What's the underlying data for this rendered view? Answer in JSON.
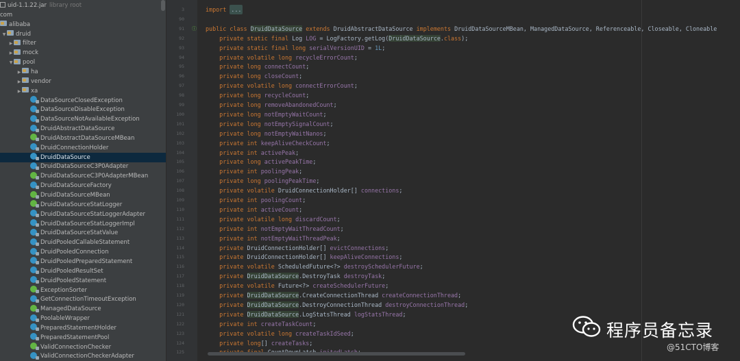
{
  "project_tree": {
    "rows": [
      {
        "label": "uid-1.1.22.jar",
        "hint": "library root",
        "icon": "jar-icon",
        "depth": 0,
        "caret": ""
      },
      {
        "label": "com",
        "icon": "none",
        "depth": 0,
        "caret": ""
      },
      {
        "label": "alibaba",
        "icon": "folder-icon",
        "depth": 0,
        "caret": ""
      },
      {
        "label": "druid",
        "icon": "folder-icon",
        "depth": 1,
        "caret": "▼"
      },
      {
        "label": "filter",
        "icon": "folder-icon",
        "depth": 2,
        "caret": "▶"
      },
      {
        "label": "mock",
        "icon": "folder-icon",
        "depth": 2,
        "caret": "▶"
      },
      {
        "label": "pool",
        "icon": "folder-icon",
        "depth": 2,
        "caret": "▼"
      },
      {
        "label": "ha",
        "icon": "folder-icon",
        "depth": 3,
        "caret": "▶"
      },
      {
        "label": "vendor",
        "icon": "folder-icon",
        "depth": 3,
        "caret": "▶"
      },
      {
        "label": "xa",
        "icon": "folder-icon",
        "depth": 3,
        "caret": "▶"
      },
      {
        "label": "DataSourceClosedException",
        "icon": "class-icon",
        "depth": 4,
        "caret": ""
      },
      {
        "label": "DataSourceDisableException",
        "icon": "class-icon",
        "depth": 4,
        "caret": ""
      },
      {
        "label": "DataSourceNotAvailableException",
        "icon": "class-icon",
        "depth": 4,
        "caret": ""
      },
      {
        "label": "DruidAbstractDataSource",
        "icon": "class-icon",
        "depth": 4,
        "caret": ""
      },
      {
        "label": "DruidAbstractDataSourceMBean",
        "icon": "interface-icon",
        "depth": 4,
        "caret": ""
      },
      {
        "label": "DruidConnectionHolder",
        "icon": "class-icon",
        "depth": 4,
        "caret": ""
      },
      {
        "label": "DruidDataSource",
        "icon": "class-icon",
        "depth": 4,
        "caret": "",
        "selected": true
      },
      {
        "label": "DruidDataSourceC3P0Adapter",
        "icon": "class-icon",
        "depth": 4,
        "caret": ""
      },
      {
        "label": "DruidDataSourceC3P0AdapterMBean",
        "icon": "interface-icon",
        "depth": 4,
        "caret": ""
      },
      {
        "label": "DruidDataSourceFactory",
        "icon": "class-icon",
        "depth": 4,
        "caret": ""
      },
      {
        "label": "DruidDataSourceMBean",
        "icon": "interface-icon",
        "depth": 4,
        "caret": ""
      },
      {
        "label": "DruidDataSourceStatLogger",
        "icon": "interface-icon",
        "depth": 4,
        "caret": ""
      },
      {
        "label": "DruidDataSourceStatLoggerAdapter",
        "icon": "class-icon",
        "depth": 4,
        "caret": ""
      },
      {
        "label": "DruidDataSourceStatLoggerImpl",
        "icon": "class-icon",
        "depth": 4,
        "caret": ""
      },
      {
        "label": "DruidDataSourceStatValue",
        "icon": "class-icon",
        "depth": 4,
        "caret": ""
      },
      {
        "label": "DruidPooledCallableStatement",
        "icon": "class-icon",
        "depth": 4,
        "caret": ""
      },
      {
        "label": "DruidPooledConnection",
        "icon": "class-icon",
        "depth": 4,
        "caret": ""
      },
      {
        "label": "DruidPooledPreparedStatement",
        "icon": "class-icon",
        "depth": 4,
        "caret": ""
      },
      {
        "label": "DruidPooledResultSet",
        "icon": "class-icon",
        "depth": 4,
        "caret": ""
      },
      {
        "label": "DruidPooledStatement",
        "icon": "class-icon",
        "depth": 4,
        "caret": ""
      },
      {
        "label": "ExceptionSorter",
        "icon": "interface-icon",
        "depth": 4,
        "caret": ""
      },
      {
        "label": "GetConnectionTimeoutException",
        "icon": "class-icon",
        "depth": 4,
        "caret": ""
      },
      {
        "label": "ManagedDataSource",
        "icon": "interface-icon",
        "depth": 4,
        "caret": ""
      },
      {
        "label": "PoolableWrapper",
        "icon": "class-icon",
        "depth": 4,
        "caret": ""
      },
      {
        "label": "PreparedStatementHolder",
        "icon": "class-icon",
        "depth": 4,
        "caret": ""
      },
      {
        "label": "PreparedStatementPool",
        "icon": "class-icon",
        "depth": 4,
        "caret": ""
      },
      {
        "label": "ValidConnectionChecker",
        "icon": "interface-icon",
        "depth": 4,
        "caret": ""
      },
      {
        "label": "ValidConnectionCheckerAdapter",
        "icon": "class-icon",
        "depth": 4,
        "caret": ""
      }
    ]
  },
  "editor": {
    "lines": [
      {
        "num": "3",
        "tokens": [
          {
            "t": "import ",
            "c": "kw"
          },
          {
            "t": "...",
            "c": "fold"
          }
        ]
      },
      {
        "num": "90",
        "tokens": []
      },
      {
        "num": "91",
        "mark": "ⓘ",
        "tokens": [
          {
            "t": "public class ",
            "c": "kw"
          },
          {
            "t": "DruidDataSource",
            "c": "hl"
          },
          {
            "t": " "
          },
          {
            "t": "extends ",
            "c": "kw"
          },
          {
            "t": "DruidAbstractDataSource "
          },
          {
            "t": "implements ",
            "c": "kw"
          },
          {
            "t": "DruidDataSourceMBean, ManagedDataSource, Referenceable, Closeable, Cloneable"
          }
        ]
      },
      {
        "num": "92",
        "tokens": [
          {
            "t": "    "
          },
          {
            "t": "private static final ",
            "c": "kw"
          },
          {
            "t": "Log "
          },
          {
            "t": "LOG",
            "c": "fld"
          },
          {
            "t": " = LogFactory.getLog("
          },
          {
            "t": "DruidDataSource",
            "c": "hl"
          },
          {
            "t": "."
          },
          {
            "t": "class",
            "c": "kw"
          },
          {
            "t": ");"
          }
        ]
      },
      {
        "num": "93",
        "tokens": [
          {
            "t": "    "
          },
          {
            "t": "private static final long ",
            "c": "kw"
          },
          {
            "t": "serialVersionUID",
            "c": "fld"
          },
          {
            "t": " = "
          },
          {
            "t": "1L",
            "c": "num"
          },
          {
            "t": ";"
          }
        ]
      },
      {
        "num": "94",
        "tokens": [
          {
            "t": "    "
          },
          {
            "t": "private volatile long ",
            "c": "kw"
          },
          {
            "t": "recycleErrorCount",
            "c": "fld"
          },
          {
            "t": ";"
          }
        ]
      },
      {
        "num": "95",
        "tokens": [
          {
            "t": "    "
          },
          {
            "t": "private long ",
            "c": "kw"
          },
          {
            "t": "connectCount",
            "c": "fld"
          },
          {
            "t": ";"
          }
        ]
      },
      {
        "num": "96",
        "tokens": [
          {
            "t": "    "
          },
          {
            "t": "private long ",
            "c": "kw"
          },
          {
            "t": "closeCount",
            "c": "fld"
          },
          {
            "t": ";"
          }
        ]
      },
      {
        "num": "97",
        "tokens": [
          {
            "t": "    "
          },
          {
            "t": "private volatile long ",
            "c": "kw"
          },
          {
            "t": "connectErrorCount",
            "c": "fld"
          },
          {
            "t": ";"
          }
        ]
      },
      {
        "num": "98",
        "tokens": [
          {
            "t": "    "
          },
          {
            "t": "private long ",
            "c": "kw"
          },
          {
            "t": "recycleCount",
            "c": "fld"
          },
          {
            "t": ";"
          }
        ]
      },
      {
        "num": "99",
        "tokens": [
          {
            "t": "    "
          },
          {
            "t": "private long ",
            "c": "kw"
          },
          {
            "t": "removeAbandonedCount",
            "c": "fld"
          },
          {
            "t": ";"
          }
        ]
      },
      {
        "num": "100",
        "tokens": [
          {
            "t": "    "
          },
          {
            "t": "private long ",
            "c": "kw"
          },
          {
            "t": "notEmptyWaitCount",
            "c": "fld"
          },
          {
            "t": ";"
          }
        ]
      },
      {
        "num": "101",
        "tokens": [
          {
            "t": "    "
          },
          {
            "t": "private long ",
            "c": "kw"
          },
          {
            "t": "notEmptySignalCount",
            "c": "fld"
          },
          {
            "t": ";"
          }
        ]
      },
      {
        "num": "102",
        "tokens": [
          {
            "t": "    "
          },
          {
            "t": "private long ",
            "c": "kw"
          },
          {
            "t": "notEmptyWaitNanos",
            "c": "fld"
          },
          {
            "t": ";"
          }
        ]
      },
      {
        "num": "103",
        "tokens": [
          {
            "t": "    "
          },
          {
            "t": "private int ",
            "c": "kw"
          },
          {
            "t": "keepAliveCheckCount",
            "c": "fld"
          },
          {
            "t": ";"
          }
        ]
      },
      {
        "num": "104",
        "tokens": [
          {
            "t": "    "
          },
          {
            "t": "private int ",
            "c": "kw"
          },
          {
            "t": "activePeak",
            "c": "fld"
          },
          {
            "t": ";"
          }
        ]
      },
      {
        "num": "105",
        "tokens": [
          {
            "t": "    "
          },
          {
            "t": "private long ",
            "c": "kw"
          },
          {
            "t": "activePeakTime",
            "c": "fld"
          },
          {
            "t": ";"
          }
        ]
      },
      {
        "num": "106",
        "tokens": [
          {
            "t": "    "
          },
          {
            "t": "private int ",
            "c": "kw"
          },
          {
            "t": "poolingPeak",
            "c": "fld"
          },
          {
            "t": ";"
          }
        ]
      },
      {
        "num": "107",
        "tokens": [
          {
            "t": "    "
          },
          {
            "t": "private long ",
            "c": "kw"
          },
          {
            "t": "poolingPeakTime",
            "c": "fld"
          },
          {
            "t": ";"
          }
        ]
      },
      {
        "num": "108",
        "tokens": [
          {
            "t": "    "
          },
          {
            "t": "private volatile ",
            "c": "kw"
          },
          {
            "t": "DruidConnectionHolder[] "
          },
          {
            "t": "connections",
            "c": "fld"
          },
          {
            "t": ";"
          }
        ]
      },
      {
        "num": "109",
        "tokens": [
          {
            "t": "    "
          },
          {
            "t": "private int ",
            "c": "kw"
          },
          {
            "t": "poolingCount",
            "c": "fld"
          },
          {
            "t": ";"
          }
        ]
      },
      {
        "num": "110",
        "tokens": [
          {
            "t": "    "
          },
          {
            "t": "private int ",
            "c": "kw"
          },
          {
            "t": "activeCount",
            "c": "fld"
          },
          {
            "t": ";"
          }
        ]
      },
      {
        "num": "111",
        "tokens": [
          {
            "t": "    "
          },
          {
            "t": "private volatile long ",
            "c": "kw"
          },
          {
            "t": "discardCount",
            "c": "fld"
          },
          {
            "t": ";"
          }
        ]
      },
      {
        "num": "112",
        "tokens": [
          {
            "t": "    "
          },
          {
            "t": "private int ",
            "c": "kw"
          },
          {
            "t": "notEmptyWaitThreadCount",
            "c": "fld"
          },
          {
            "t": ";"
          }
        ]
      },
      {
        "num": "113",
        "tokens": [
          {
            "t": "    "
          },
          {
            "t": "private int ",
            "c": "kw"
          },
          {
            "t": "notEmptyWaitThreadPeak",
            "c": "fld"
          },
          {
            "t": ";"
          }
        ]
      },
      {
        "num": "114",
        "tokens": [
          {
            "t": "    "
          },
          {
            "t": "private ",
            "c": "kw"
          },
          {
            "t": "DruidConnectionHolder[] "
          },
          {
            "t": "evictConnections",
            "c": "fld"
          },
          {
            "t": ";"
          }
        ]
      },
      {
        "num": "115",
        "tokens": [
          {
            "t": "    "
          },
          {
            "t": "private ",
            "c": "kw"
          },
          {
            "t": "DruidConnectionHolder[] "
          },
          {
            "t": "keepAliveConnections",
            "c": "fld"
          },
          {
            "t": ";"
          }
        ]
      },
      {
        "num": "116",
        "tokens": [
          {
            "t": "    "
          },
          {
            "t": "private volatile ",
            "c": "kw"
          },
          {
            "t": "ScheduledFuture<?> "
          },
          {
            "t": "destroySchedulerFuture",
            "c": "fld"
          },
          {
            "t": ";"
          }
        ]
      },
      {
        "num": "117",
        "tokens": [
          {
            "t": "    "
          },
          {
            "t": "private ",
            "c": "kw"
          },
          {
            "t": "DruidDataSource",
            "c": "hl"
          },
          {
            "t": ".DestroyTask "
          },
          {
            "t": "destroyTask",
            "c": "fld"
          },
          {
            "t": ";"
          }
        ]
      },
      {
        "num": "118",
        "tokens": [
          {
            "t": "    "
          },
          {
            "t": "private volatile ",
            "c": "kw"
          },
          {
            "t": "Future<?> "
          },
          {
            "t": "createSchedulerFuture",
            "c": "fld"
          },
          {
            "t": ";"
          }
        ]
      },
      {
        "num": "119",
        "tokens": [
          {
            "t": "    "
          },
          {
            "t": "private ",
            "c": "kw"
          },
          {
            "t": "DruidDataSource",
            "c": "hl"
          },
          {
            "t": ".CreateConnectionThread "
          },
          {
            "t": "createConnectionThread",
            "c": "fld"
          },
          {
            "t": ";"
          }
        ]
      },
      {
        "num": "120",
        "tokens": [
          {
            "t": "    "
          },
          {
            "t": "private ",
            "c": "kw"
          },
          {
            "t": "DruidDataSource",
            "c": "hl"
          },
          {
            "t": ".DestroyConnectionThread "
          },
          {
            "t": "destroyConnectionThread",
            "c": "fld"
          },
          {
            "t": ";"
          }
        ]
      },
      {
        "num": "121",
        "tokens": [
          {
            "t": "    "
          },
          {
            "t": "private ",
            "c": "kw"
          },
          {
            "t": "DruidDataSource",
            "c": "hl"
          },
          {
            "t": ".LogStatsThread "
          },
          {
            "t": "logStatsThread",
            "c": "fld"
          },
          {
            "t": ";"
          }
        ]
      },
      {
        "num": "122",
        "tokens": [
          {
            "t": "    "
          },
          {
            "t": "private int ",
            "c": "kw"
          },
          {
            "t": "createTaskCount",
            "c": "fld"
          },
          {
            "t": ";"
          }
        ]
      },
      {
        "num": "123",
        "tokens": [
          {
            "t": "    "
          },
          {
            "t": "private volatile long ",
            "c": "kw"
          },
          {
            "t": "createTaskIdSeed",
            "c": "fld"
          },
          {
            "t": ";"
          }
        ]
      },
      {
        "num": "124",
        "tokens": [
          {
            "t": "    "
          },
          {
            "t": "private long",
            "c": "kw"
          },
          {
            "t": "[] "
          },
          {
            "t": "createTasks",
            "c": "fld"
          },
          {
            "t": ";"
          }
        ]
      },
      {
        "num": "125",
        "tokens": [
          {
            "t": "    "
          },
          {
            "t": "private final ",
            "c": "kw"
          },
          {
            "t": "CountDownLatch "
          },
          {
            "t": "initedLatch",
            "c": "fld"
          },
          {
            "t": ";"
          }
        ]
      }
    ]
  },
  "watermark": {
    "title": "程序员备忘录",
    "site": "@51CTO博客"
  },
  "colors": {
    "keyword": "#cc7832",
    "field": "#9876aa",
    "number": "#6897bb",
    "text": "#a9b7c6",
    "highlight": "#344134",
    "tree_selected": "#0d293e"
  }
}
